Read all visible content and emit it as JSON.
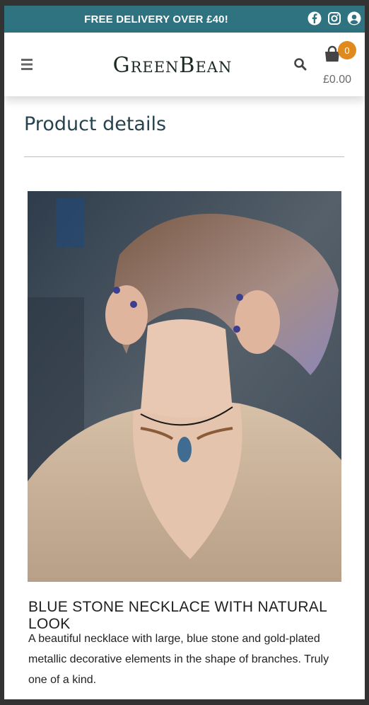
{
  "banner": {
    "text": "FREE DELIVERY OVER £40!",
    "background": "#2f7280"
  },
  "header": {
    "logo": "GreenBean",
    "cart_count": "0",
    "cart_total": "£0.00",
    "icons": [
      "menu-icon",
      "search-icon",
      "cart-icon",
      "facebook-icon",
      "instagram-icon",
      "user-icon"
    ],
    "accent": "#e08a1e"
  },
  "page": {
    "title": "Product details",
    "title_color": "#26434f"
  },
  "product": {
    "name": "BLUE STONE NECKLACE WITH NATURAL LOOK",
    "description": "A beautiful necklace with large, blue stone and gold-plated metallic decorative elements in the shape of branches. Truly one of a kind."
  }
}
